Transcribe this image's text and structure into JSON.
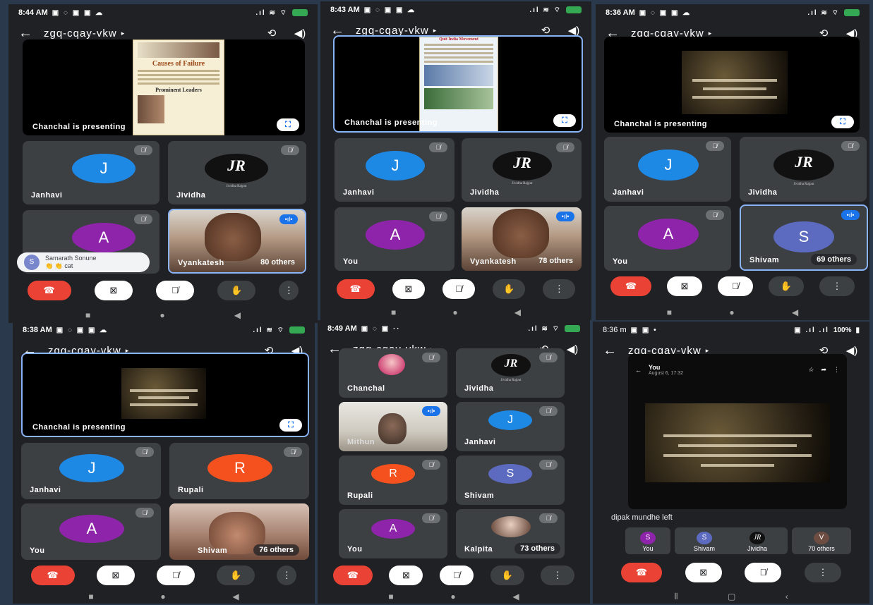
{
  "meeting_code": "zgq-cqay-vkw",
  "icons": {
    "back": "arrow-left-icon",
    "flip": "switch-camera-icon",
    "audio": "speaker-icon"
  },
  "colors": {
    "end_call": "#ea4335",
    "speaking": "#8ab4f8",
    "tile": "#3c4043",
    "bg": "#202124"
  },
  "presenting_label": "Chanchal is presenting",
  "panels": [
    {
      "time": "8:44 AM",
      "slide_headings": [
        "Causes of Failure",
        "Prominent Leaders"
      ],
      "tiles": [
        {
          "name": "Janhavi",
          "initial": "J"
        },
        {
          "name": "Jividha",
          "logo_text": "JR",
          "logo_sub": "Jividha Rajput"
        },
        {
          "name": "",
          "initial": "A"
        },
        {
          "name": "Vyankatesh",
          "others": "80 others"
        }
      ],
      "toast": {
        "initial": "S",
        "name": "Samarath Sonune",
        "message": "👏 👏 cat"
      }
    },
    {
      "time": "8:43 AM",
      "slide_headings": [
        "Quit India Movement"
      ],
      "tiles": [
        {
          "name": "Janhavi",
          "initial": "J"
        },
        {
          "name": "Jividha",
          "logo_text": "JR",
          "logo_sub": "Jividha Rajput"
        },
        {
          "name": "You",
          "initial": "A"
        },
        {
          "name": "Vyankatesh",
          "others": "78 others"
        }
      ]
    },
    {
      "time": "8:36 AM",
      "tiles": [
        {
          "name": "Janhavi",
          "initial": "J"
        },
        {
          "name": "Jividha",
          "logo_text": "JR",
          "logo_sub": "Jividha Rajput"
        },
        {
          "name": "You",
          "initial": "A"
        },
        {
          "name": "Shivam",
          "initial": "S",
          "others": "69 others"
        }
      ]
    },
    {
      "time": "8:38 AM",
      "tiles": [
        {
          "name": "Janhavi",
          "initial": "J"
        },
        {
          "name": "Rupali",
          "initial": "R"
        },
        {
          "name": "You",
          "initial": "A"
        },
        {
          "name": "Shivam",
          "others": "76 others"
        }
      ]
    },
    {
      "time": "8:49 AM",
      "tiles": [
        {
          "name": "Chanchal"
        },
        {
          "name": "Jividha",
          "logo_text": "JR",
          "logo_sub": "Jividha Rajput"
        },
        {
          "name": "Mithun"
        },
        {
          "name": "Janhavi",
          "initial": "J"
        },
        {
          "name": "Rupali",
          "initial": "R"
        },
        {
          "name": "Shivam",
          "initial": "S"
        },
        {
          "name": "You",
          "initial": "A"
        },
        {
          "name": "Kalpita",
          "others": "73 others"
        }
      ]
    },
    {
      "time": "8:36 m",
      "battery": "100%",
      "shared_header": {
        "name": "You",
        "date": "August 6, 17:32"
      },
      "left_message": "dipak mundhe left",
      "mini_tiles": [
        {
          "name": "You",
          "initial": "S"
        },
        {
          "name": "Shivam",
          "initial": "S"
        },
        {
          "name": "Jividha",
          "logo_text": "JR"
        },
        {
          "name": "70 others",
          "initial": "V"
        }
      ]
    }
  ]
}
